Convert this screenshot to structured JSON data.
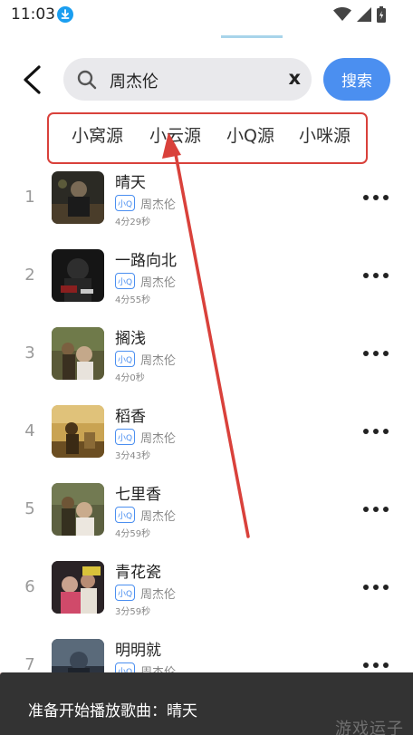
{
  "status_bar": {
    "time": "11:03"
  },
  "header": {
    "search_value": "周杰伦",
    "clear_label": "x",
    "search_button": "搜索"
  },
  "source_tabs": [
    {
      "label": "小窝源"
    },
    {
      "label": "小云源"
    },
    {
      "label": "小Q源",
      "selected": true
    },
    {
      "label": "小咪源"
    }
  ],
  "songs": [
    {
      "index": "1",
      "title": "晴天",
      "badge": "小Q",
      "artist": "周杰伦",
      "duration": "4分29秒"
    },
    {
      "index": "2",
      "title": "一路向北",
      "badge": "小Q",
      "artist": "周杰伦",
      "duration": "4分55秒"
    },
    {
      "index": "3",
      "title": "搁浅",
      "badge": "小Q",
      "artist": "周杰伦",
      "duration": "4分0秒"
    },
    {
      "index": "4",
      "title": "稻香",
      "badge": "小Q",
      "artist": "周杰伦",
      "duration": "3分43秒"
    },
    {
      "index": "5",
      "title": "七里香",
      "badge": "小Q",
      "artist": "周杰伦",
      "duration": "4分59秒"
    },
    {
      "index": "6",
      "title": "青花瓷",
      "badge": "小Q",
      "artist": "周杰伦",
      "duration": "3分59秒"
    },
    {
      "index": "7",
      "title": "明明就",
      "badge": "小Q",
      "artist": "周杰伦",
      "duration": ""
    }
  ],
  "toast": {
    "message": "准备开始播放歌曲：晴天"
  },
  "watermark": "游戏运子",
  "colors": {
    "accent": "#4b8ff0",
    "annotation": "#d9413b",
    "toast_bg": "#333333"
  },
  "icons": [
    "back-arrow-icon",
    "search-icon",
    "more-dots-icon",
    "download-icon",
    "wifi-icon",
    "signal-icon",
    "battery-icon"
  ]
}
